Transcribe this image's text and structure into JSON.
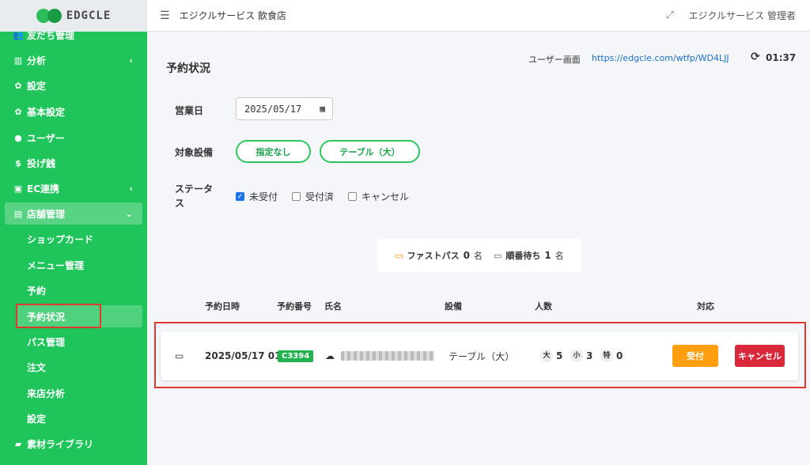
{
  "logo": {
    "text": "EDGCLE"
  },
  "sidebar": {
    "items": [
      {
        "label": "友だち管理",
        "icon": "users-icon"
      },
      {
        "label": "分析",
        "icon": "chart-icon"
      },
      {
        "label": "設定",
        "icon": "gear-icon"
      },
      {
        "label": "基本設定",
        "icon": "gear-icon"
      },
      {
        "label": "ユーザー",
        "icon": "user-icon"
      },
      {
        "label": "投げ銭",
        "icon": "dollar-icon"
      },
      {
        "label": "EC連携",
        "icon": "shopping-bag-icon"
      },
      {
        "label": "店舗管理",
        "icon": "store-icon"
      },
      {
        "label": "素材ライブラリ",
        "icon": "folder-icon"
      }
    ],
    "subitems": [
      {
        "label": "ショップカード"
      },
      {
        "label": "メニュー管理"
      },
      {
        "label": "予約"
      },
      {
        "label": "予約状況"
      },
      {
        "label": "パス管理"
      },
      {
        "label": "注文"
      },
      {
        "label": "来店分析"
      },
      {
        "label": "設定"
      }
    ]
  },
  "topbar": {
    "store_name": "エジクルサービス 飲食店",
    "admin_name": "エジクルサービス 管理者"
  },
  "main": {
    "title": "予約状況",
    "user_screen_label": "ユーザー画面",
    "user_screen_url": "https://edgcle.com/wtfp/WD4LJJ",
    "clock": "01:37",
    "business_day_label": "営業日",
    "business_day_value": "2025/05/17",
    "facility_label": "対象設備",
    "facility_options": [
      "指定なし",
      "テーブル（大）"
    ],
    "status_label": "ステータス",
    "status_options": [
      {
        "label": "未受付",
        "checked": true
      },
      {
        "label": "受付済",
        "checked": false
      },
      {
        "label": "キャンセル",
        "checked": false
      }
    ],
    "summary": {
      "fastpass_label": "ファストパス",
      "fastpass_count": "0",
      "queue_label": "順番待ち",
      "queue_count": "1",
      "unit": "名"
    },
    "table": {
      "headers": [
        "予約日時",
        "予約番号",
        "氏名",
        "設備",
        "人数",
        "対応"
      ],
      "rows": [
        {
          "datetime": "2025/05/17 01:15",
          "code": "C3394",
          "facility": "テーブル（大）",
          "counts": [
            {
              "label": "大",
              "value": "5"
            },
            {
              "label": "小",
              "value": "3"
            },
            {
              "label": "特",
              "value": "0"
            }
          ],
          "accept_label": "受付",
          "cancel_label": "キャンセル"
        }
      ]
    }
  },
  "colors": {
    "sidebar_bg": "#1fc45a",
    "accent_green": "#2dc65f",
    "accept_orange": "#ff9f0f",
    "cancel_red": "#d9283a",
    "highlight_red": "#e03a2f"
  }
}
